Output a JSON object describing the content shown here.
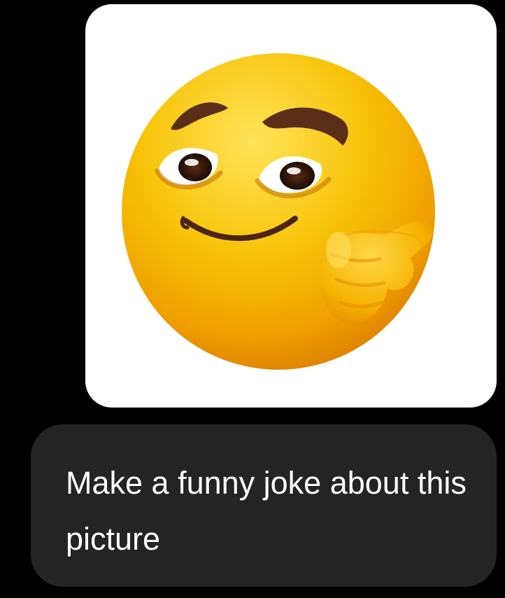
{
  "chat": {
    "image_message": {
      "alt": "smirking emoji pointing finger",
      "icon": "smirk-pointing-emoji-icon"
    },
    "text_message": {
      "text": "Make a funny joke about this picture"
    }
  },
  "colors": {
    "background": "#000000",
    "bubble": "#242424",
    "text": "#ffffff",
    "emoji_yellow": "#f5c000",
    "emoji_orange": "#e38600"
  }
}
